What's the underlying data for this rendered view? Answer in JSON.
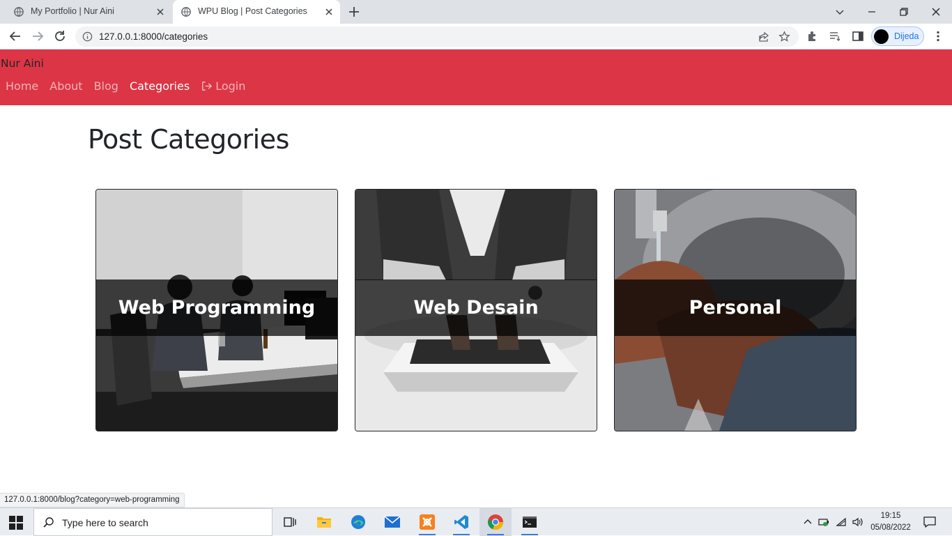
{
  "browser": {
    "tabs": [
      {
        "title": "My Portfolio | Nur Aini",
        "active": false
      },
      {
        "title": "WPU Blog | Post Categories",
        "active": true
      }
    ],
    "url": "127.0.0.1:8000/categories",
    "profile_name": "Dijeda",
    "status_url": "127.0.0.1:8000/blog?category=web-programming"
  },
  "site": {
    "brand": "Nur Aini",
    "nav": [
      {
        "label": "Home",
        "active": false
      },
      {
        "label": "About",
        "active": false
      },
      {
        "label": "Blog",
        "active": false
      },
      {
        "label": "Categories",
        "active": true
      },
      {
        "label": "Login",
        "active": false,
        "icon": "login-icon"
      }
    ],
    "page_title": "Post Categories",
    "categories": [
      {
        "name": "Web Programming",
        "image": "people-at-desk-photo"
      },
      {
        "name": "Web Desain",
        "image": "hands-typing-laptop-photo"
      },
      {
        "name": "Personal",
        "image": "washing-hands-photo"
      }
    ],
    "accent_color": "#dc3545"
  },
  "taskbar": {
    "search_placeholder": "Type here to search",
    "apps": [
      "task-view-icon",
      "file-explorer-icon",
      "edge-icon",
      "mail-icon",
      "xampp-icon",
      "vscode-icon",
      "chrome-icon",
      "terminal-icon"
    ],
    "time": "19:15",
    "date": "05/08/2022"
  }
}
